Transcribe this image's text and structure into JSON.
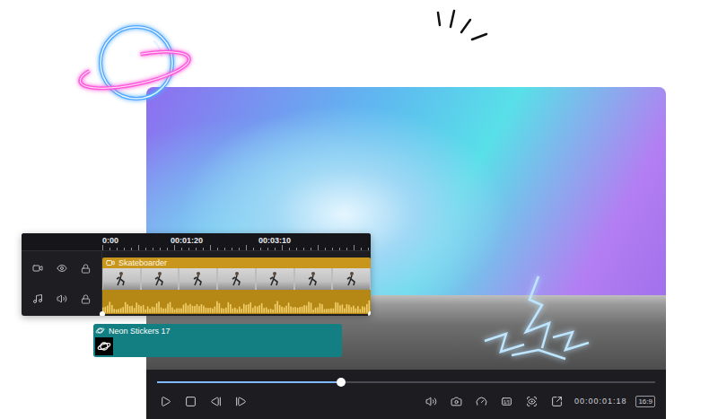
{
  "timeline": {
    "ruler": [
      "0:00",
      "00:01:20",
      "00:03:10"
    ],
    "clip": {
      "label": "Skateboarder"
    },
    "sticker": {
      "label": "Neon Stickers 17"
    }
  },
  "player": {
    "progress": 0.37,
    "time": "00:00:01:18",
    "aspect": "16:9"
  }
}
